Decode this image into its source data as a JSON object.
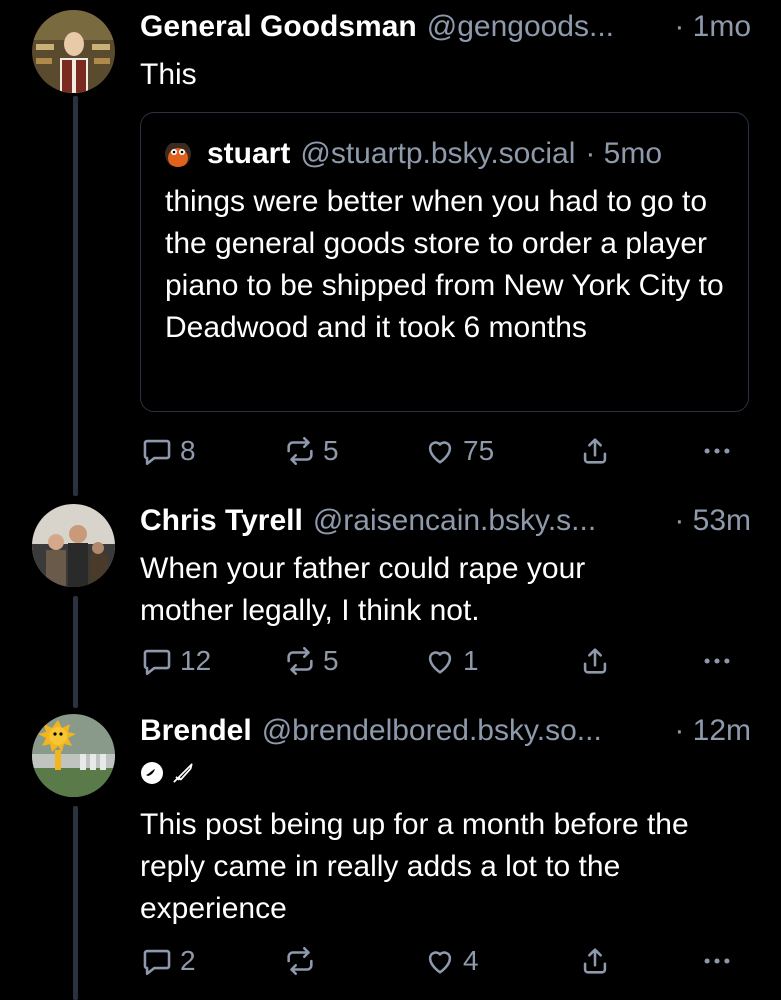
{
  "posts": [
    {
      "name": "General Goodsman",
      "handle": "@gengoods...",
      "time": "· 1mo",
      "text": "This",
      "avatar_icon": "general-store-shopkeeper-avatar",
      "quote": {
        "name": "stuart",
        "handle": "@stuartp.bsky.social",
        "time": "· 5mo",
        "avatar_icon": "orange-puppet-avatar",
        "text": "things were better when you had to go to the general goods store to order a player piano to be shipped from New York City to Deadwood and it took 6 months"
      },
      "replies": "8",
      "reposts": "5",
      "likes": "75"
    },
    {
      "name": "Chris Tyrell",
      "handle": "@raisencain.bsky.s...",
      "time": "· 53m",
      "text": "When your father could rape your mother legally, I think not.",
      "avatar_icon": "family-photo-avatar",
      "replies": "12",
      "reposts": "5",
      "likes": "1"
    },
    {
      "name": "Brendel",
      "handle": "@brendelbored.bsky.so...",
      "time": "· 12m",
      "text": "This post being up for a month before the reply came in really adds a lot to the experience",
      "avatar_icon": "sun-mascot-crowd-avatar",
      "replies": "2",
      "reposts": "",
      "likes": "4"
    }
  ],
  "colors": {
    "background": "#000000",
    "text": "#ffffff",
    "muted": "#8e9aab",
    "thread_line": "#2a3240"
  }
}
